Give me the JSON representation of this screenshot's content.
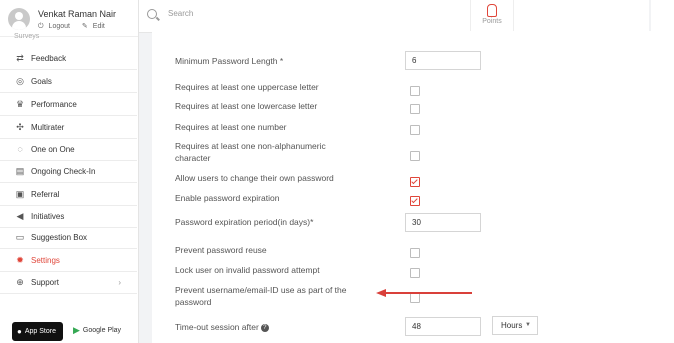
{
  "user": {
    "name": "Venkat Raman Nair",
    "logout": "Logout",
    "edit": "Edit"
  },
  "nav": {
    "partial_label": "Surveys",
    "items": [
      {
        "label": "Feedback",
        "icon": "feedback-icon"
      },
      {
        "label": "Goals",
        "icon": "goals-icon"
      },
      {
        "label": "Performance",
        "icon": "trophy-icon"
      },
      {
        "label": "Multirater",
        "icon": "multirater-icon"
      },
      {
        "label": "One on One",
        "icon": "chat-icon"
      },
      {
        "label": "Ongoing Check-In",
        "icon": "calendar-icon"
      },
      {
        "label": "Referral",
        "icon": "referral-icon"
      },
      {
        "label": "Initiatives",
        "icon": "megaphone-icon"
      },
      {
        "label": "Suggestion Box",
        "icon": "box-icon"
      },
      {
        "label": "Settings",
        "icon": "gear-icon",
        "active": true
      },
      {
        "label": "Support",
        "icon": "lifebuoy-icon",
        "has_submenu": true
      }
    ]
  },
  "stores": {
    "app_store": "App Store",
    "google_play": "Google Play"
  },
  "search": {
    "placeholder": "Search"
  },
  "points": {
    "label": "Points"
  },
  "settings": {
    "min_length_label": "Minimum Password Length *",
    "min_length_value": "6",
    "uppercase_label": "Requires at least one uppercase letter",
    "uppercase_checked": false,
    "lowercase_label": "Requires at least one lowercase letter",
    "lowercase_checked": false,
    "number_label": "Requires at least one number",
    "number_checked": false,
    "special_label_line1": "Requires at least one non-alphanumeric",
    "special_label_line2": "character",
    "special_checked": false,
    "allow_change_label": "Allow users to change their own password",
    "allow_change_checked": true,
    "expiration_label": "Enable password expiration",
    "expiration_checked": true,
    "expiration_period_label": "Password expiration period(in days)*",
    "expiration_period_value": "30",
    "reuse_label": "Prevent password reuse",
    "reuse_checked": false,
    "lock_label": "Lock user on invalid password attempt",
    "lock_checked": false,
    "prevent_username_line1": "Prevent username/email-ID use as part of the",
    "prevent_username_line2": "password",
    "prevent_username_checked": false,
    "timeout_label": "Time-out session after",
    "timeout_value": "48",
    "timeout_unit": "Hours"
  },
  "colors": {
    "accent": "#e0463a",
    "arrow": "#d9403a"
  }
}
